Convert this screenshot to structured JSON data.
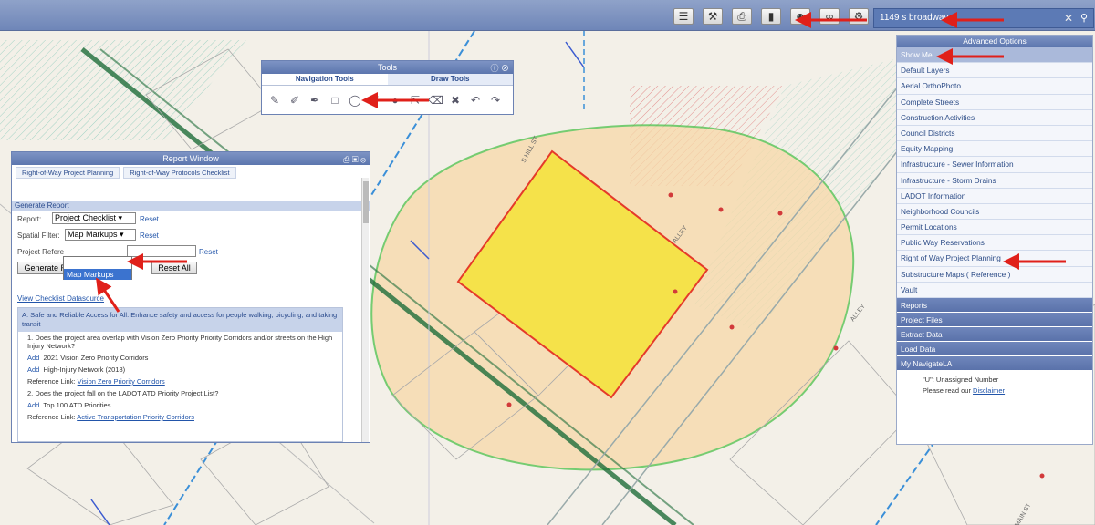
{
  "search": {
    "value": "1149 s broadway"
  },
  "toolbar": {
    "icons": [
      "layers-icon",
      "tools-icon",
      "print-icon",
      "markup-icon",
      "user-icon",
      "link-icon",
      "settings-icon"
    ]
  },
  "tools_window": {
    "title": "Tools",
    "tabs": [
      "Navigation Tools",
      "Draw Tools"
    ]
  },
  "report_window": {
    "title": "Report Window",
    "tabs": [
      "Right-of-Way Project Planning",
      "Right-of-Way Protocols Checklist"
    ],
    "section": "Generate Report",
    "report_label": "Report:",
    "report_value": "Project Checklist",
    "reset": "Reset",
    "spatial_label": "Spatial Filter:",
    "spatial_value": "Map Markups",
    "project_ref_label": "Project Refere",
    "dropdown_option": "Map Markups",
    "generate_label": "Generate Report",
    "reset_all_label": "Reset All",
    "view_link": "View Checklist Datasource",
    "checklist": {
      "header": "A. Safe and Reliable Access for All: Enhance safety and access for people walking, bicycling, and taking transit",
      "q1": "1. Does the project area overlap with Vision Zero Priority Priority Corridors and/or streets on the High Injury Network?",
      "q1_items": [
        "2021 Vision Zero Priority Corridors",
        "High-Injury Network (2018)"
      ],
      "add": "Add",
      "ref_label": "Reference Link:",
      "q1_ref": "Vision Zero Priority Corridors",
      "q2": "2. Does the project fall on the LADOT ATD Priority Project List?",
      "q2_items": [
        "Top 100 ATD Priorities"
      ],
      "q2_ref": "Active Transportation Priority Corridors"
    }
  },
  "advanced": {
    "title": "Advanced Options",
    "items": [
      "Show Me",
      "Default Layers",
      "Aerial OrthoPhoto",
      "Complete Streets",
      "Construction Activities",
      "Council Districts",
      "Equity Mapping",
      "Infrastructure - Sewer Information",
      "Infrastructure - Storm Drains",
      "LADOT Information",
      "Neighborhood Councils",
      "Permit Locations",
      "Public Way Reservations",
      "Right of Way Project Planning",
      "Substructure Maps ( Reference )",
      "Vault"
    ],
    "sections": [
      "Reports",
      "Project Files",
      "Extract Data",
      "Load Data",
      "My NavigateLA"
    ],
    "foot1": "\"U\": Unassigned Number",
    "foot2": "Please read our ",
    "foot_link": "Disclaimer"
  },
  "map_labels": [
    "ALLEY",
    "ALLEY",
    "S HILL ST",
    "S MAIN ST"
  ],
  "colors": {
    "highlight_arrow": "#e0201a",
    "buffer": "#f7d9a8",
    "parcel": "#f5e24a",
    "green_outline": "#4cc04a"
  }
}
